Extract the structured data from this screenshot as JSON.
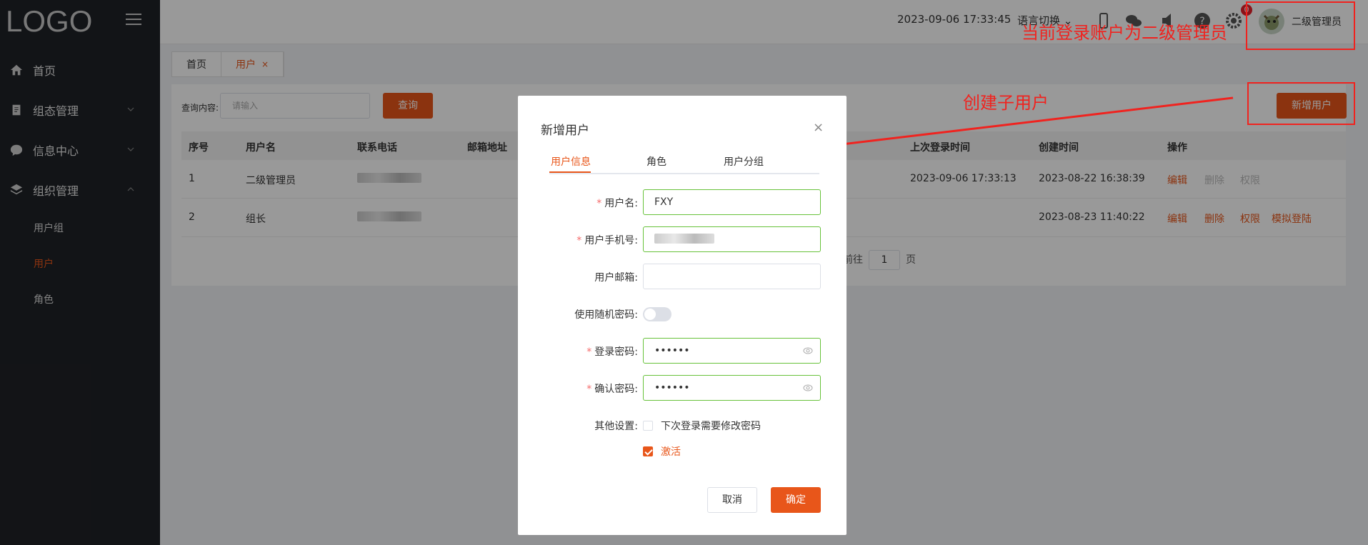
{
  "sidebar": {
    "logo": "LOGO",
    "items": [
      {
        "label": "首页",
        "icon": "home-icon"
      },
      {
        "label": "组态管理",
        "icon": "clipboard-icon"
      },
      {
        "label": "信息中心",
        "icon": "chat-icon"
      },
      {
        "label": "组织管理",
        "icon": "layers-icon"
      }
    ],
    "subitems": [
      {
        "label": "用户组",
        "active": false
      },
      {
        "label": "用户",
        "active": true
      },
      {
        "label": "角色",
        "active": false
      }
    ]
  },
  "header": {
    "datetime": "2023-09-06 17:33:45",
    "language": "语言切换",
    "notification_count": "0",
    "username": "二级管理员"
  },
  "annotations": {
    "login_note": "当前登录账户为二级管理员",
    "create_note": "创建子用户",
    "color": "#f0231f"
  },
  "tabs": [
    {
      "label": "首页",
      "active": false
    },
    {
      "label": "用户",
      "active": true,
      "close": "×"
    }
  ],
  "query": {
    "label": "查询内容:",
    "placeholder": "请输入",
    "button": "查询",
    "add_button": "新增用户"
  },
  "table": {
    "columns": [
      "序号",
      "用户名",
      "联系电话",
      "邮箱地址",
      "上次登录时间",
      "创建时间",
      "操作"
    ],
    "rows": [
      {
        "index": "1",
        "username": "二级管理员",
        "last_login": "2023-09-06 17:33:13",
        "created": "2023-08-22 16:38:39",
        "ops": [
          "编辑",
          "删除",
          "权限"
        ]
      },
      {
        "index": "2",
        "username": "组长",
        "last_login": "",
        "created": "2023-08-23 11:40:22",
        "ops": [
          "编辑",
          "删除",
          "权限",
          "模拟登陆"
        ]
      }
    ],
    "pager": {
      "prefix": "前往",
      "page": "1",
      "suffix": "页"
    }
  },
  "modal": {
    "title": "新增用户",
    "close": "×",
    "tabs": [
      "用户信息",
      "角色",
      "用户分组"
    ],
    "fields": {
      "username": {
        "label": "用户名:",
        "value": "FXY"
      },
      "phone": {
        "label": "用户手机号:"
      },
      "email": {
        "label": "用户邮箱:",
        "value": ""
      },
      "random_pwd": {
        "label": "使用随机密码:"
      },
      "password": {
        "label": "登录密码:",
        "value": "••••••"
      },
      "confirm": {
        "label": "确认密码:",
        "value": "••••••"
      },
      "other": {
        "label": "其他设置:"
      }
    },
    "options": [
      {
        "label": "下次登录需要修改密码",
        "checked": false
      },
      {
        "label": "激活",
        "checked": true
      }
    ],
    "cancel": "取消",
    "ok": "确定"
  },
  "colors": {
    "accent": "#e8561a",
    "sidebar": "#1f2227",
    "success_border": "#67c23a"
  }
}
